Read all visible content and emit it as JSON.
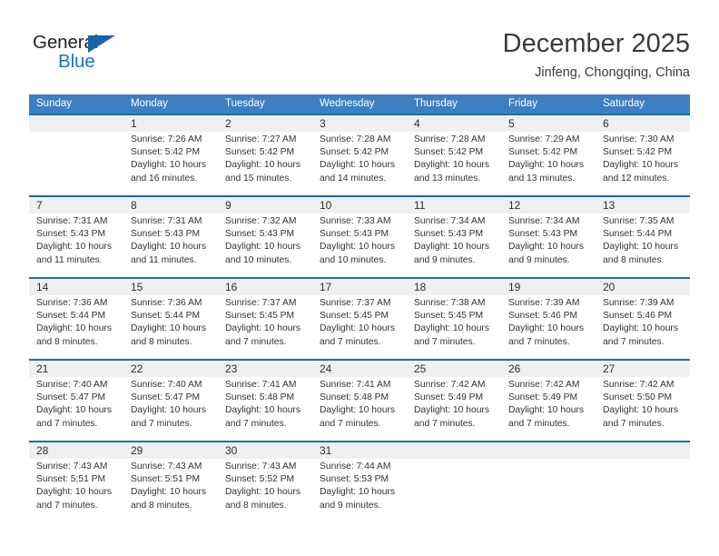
{
  "brand": {
    "name_part1": "General",
    "name_part2": "Blue",
    "triangle_color": "#1565a8",
    "blue_color": "#1777c4"
  },
  "header": {
    "title": "December 2025",
    "location": "Jinfeng, Chongqing, China"
  },
  "colors": {
    "header_blue": "#3d7fc1",
    "rule_blue": "#1f6cb0",
    "band_gray": "#f0f0f0",
    "text": "#333333"
  },
  "weekdays": [
    "Sunday",
    "Monday",
    "Tuesday",
    "Wednesday",
    "Thursday",
    "Friday",
    "Saturday"
  ],
  "weeks": [
    {
      "days": [
        {
          "num": "",
          "sunrise": "",
          "sunset": "",
          "daylight_line1": "",
          "daylight_line2": ""
        },
        {
          "num": "1",
          "sunrise": "Sunrise: 7:26 AM",
          "sunset": "Sunset: 5:42 PM",
          "daylight_line1": "Daylight: 10 hours",
          "daylight_line2": "and 16 minutes."
        },
        {
          "num": "2",
          "sunrise": "Sunrise: 7:27 AM",
          "sunset": "Sunset: 5:42 PM",
          "daylight_line1": "Daylight: 10 hours",
          "daylight_line2": "and 15 minutes."
        },
        {
          "num": "3",
          "sunrise": "Sunrise: 7:28 AM",
          "sunset": "Sunset: 5:42 PM",
          "daylight_line1": "Daylight: 10 hours",
          "daylight_line2": "and 14 minutes."
        },
        {
          "num": "4",
          "sunrise": "Sunrise: 7:28 AM",
          "sunset": "Sunset: 5:42 PM",
          "daylight_line1": "Daylight: 10 hours",
          "daylight_line2": "and 13 minutes."
        },
        {
          "num": "5",
          "sunrise": "Sunrise: 7:29 AM",
          "sunset": "Sunset: 5:42 PM",
          "daylight_line1": "Daylight: 10 hours",
          "daylight_line2": "and 13 minutes."
        },
        {
          "num": "6",
          "sunrise": "Sunrise: 7:30 AM",
          "sunset": "Sunset: 5:42 PM",
          "daylight_line1": "Daylight: 10 hours",
          "daylight_line2": "and 12 minutes."
        }
      ]
    },
    {
      "days": [
        {
          "num": "7",
          "sunrise": "Sunrise: 7:31 AM",
          "sunset": "Sunset: 5:43 PM",
          "daylight_line1": "Daylight: 10 hours",
          "daylight_line2": "and 11 minutes."
        },
        {
          "num": "8",
          "sunrise": "Sunrise: 7:31 AM",
          "sunset": "Sunset: 5:43 PM",
          "daylight_line1": "Daylight: 10 hours",
          "daylight_line2": "and 11 minutes."
        },
        {
          "num": "9",
          "sunrise": "Sunrise: 7:32 AM",
          "sunset": "Sunset: 5:43 PM",
          "daylight_line1": "Daylight: 10 hours",
          "daylight_line2": "and 10 minutes."
        },
        {
          "num": "10",
          "sunrise": "Sunrise: 7:33 AM",
          "sunset": "Sunset: 5:43 PM",
          "daylight_line1": "Daylight: 10 hours",
          "daylight_line2": "and 10 minutes."
        },
        {
          "num": "11",
          "sunrise": "Sunrise: 7:34 AM",
          "sunset": "Sunset: 5:43 PM",
          "daylight_line1": "Daylight: 10 hours",
          "daylight_line2": "and 9 minutes."
        },
        {
          "num": "12",
          "sunrise": "Sunrise: 7:34 AM",
          "sunset": "Sunset: 5:43 PM",
          "daylight_line1": "Daylight: 10 hours",
          "daylight_line2": "and 9 minutes."
        },
        {
          "num": "13",
          "sunrise": "Sunrise: 7:35 AM",
          "sunset": "Sunset: 5:44 PM",
          "daylight_line1": "Daylight: 10 hours",
          "daylight_line2": "and 8 minutes."
        }
      ]
    },
    {
      "days": [
        {
          "num": "14",
          "sunrise": "Sunrise: 7:36 AM",
          "sunset": "Sunset: 5:44 PM",
          "daylight_line1": "Daylight: 10 hours",
          "daylight_line2": "and 8 minutes."
        },
        {
          "num": "15",
          "sunrise": "Sunrise: 7:36 AM",
          "sunset": "Sunset: 5:44 PM",
          "daylight_line1": "Daylight: 10 hours",
          "daylight_line2": "and 8 minutes."
        },
        {
          "num": "16",
          "sunrise": "Sunrise: 7:37 AM",
          "sunset": "Sunset: 5:45 PM",
          "daylight_line1": "Daylight: 10 hours",
          "daylight_line2": "and 7 minutes."
        },
        {
          "num": "17",
          "sunrise": "Sunrise: 7:37 AM",
          "sunset": "Sunset: 5:45 PM",
          "daylight_line1": "Daylight: 10 hours",
          "daylight_line2": "and 7 minutes."
        },
        {
          "num": "18",
          "sunrise": "Sunrise: 7:38 AM",
          "sunset": "Sunset: 5:45 PM",
          "daylight_line1": "Daylight: 10 hours",
          "daylight_line2": "and 7 minutes."
        },
        {
          "num": "19",
          "sunrise": "Sunrise: 7:39 AM",
          "sunset": "Sunset: 5:46 PM",
          "daylight_line1": "Daylight: 10 hours",
          "daylight_line2": "and 7 minutes."
        },
        {
          "num": "20",
          "sunrise": "Sunrise: 7:39 AM",
          "sunset": "Sunset: 5:46 PM",
          "daylight_line1": "Daylight: 10 hours",
          "daylight_line2": "and 7 minutes."
        }
      ]
    },
    {
      "days": [
        {
          "num": "21",
          "sunrise": "Sunrise: 7:40 AM",
          "sunset": "Sunset: 5:47 PM",
          "daylight_line1": "Daylight: 10 hours",
          "daylight_line2": "and 7 minutes."
        },
        {
          "num": "22",
          "sunrise": "Sunrise: 7:40 AM",
          "sunset": "Sunset: 5:47 PM",
          "daylight_line1": "Daylight: 10 hours",
          "daylight_line2": "and 7 minutes."
        },
        {
          "num": "23",
          "sunrise": "Sunrise: 7:41 AM",
          "sunset": "Sunset: 5:48 PM",
          "daylight_line1": "Daylight: 10 hours",
          "daylight_line2": "and 7 minutes."
        },
        {
          "num": "24",
          "sunrise": "Sunrise: 7:41 AM",
          "sunset": "Sunset: 5:48 PM",
          "daylight_line1": "Daylight: 10 hours",
          "daylight_line2": "and 7 minutes."
        },
        {
          "num": "25",
          "sunrise": "Sunrise: 7:42 AM",
          "sunset": "Sunset: 5:49 PM",
          "daylight_line1": "Daylight: 10 hours",
          "daylight_line2": "and 7 minutes."
        },
        {
          "num": "26",
          "sunrise": "Sunrise: 7:42 AM",
          "sunset": "Sunset: 5:49 PM",
          "daylight_line1": "Daylight: 10 hours",
          "daylight_line2": "and 7 minutes."
        },
        {
          "num": "27",
          "sunrise": "Sunrise: 7:42 AM",
          "sunset": "Sunset: 5:50 PM",
          "daylight_line1": "Daylight: 10 hours",
          "daylight_line2": "and 7 minutes."
        }
      ]
    },
    {
      "days": [
        {
          "num": "28",
          "sunrise": "Sunrise: 7:43 AM",
          "sunset": "Sunset: 5:51 PM",
          "daylight_line1": "Daylight: 10 hours",
          "daylight_line2": "and 7 minutes."
        },
        {
          "num": "29",
          "sunrise": "Sunrise: 7:43 AM",
          "sunset": "Sunset: 5:51 PM",
          "daylight_line1": "Daylight: 10 hours",
          "daylight_line2": "and 8 minutes."
        },
        {
          "num": "30",
          "sunrise": "Sunrise: 7:43 AM",
          "sunset": "Sunset: 5:52 PM",
          "daylight_line1": "Daylight: 10 hours",
          "daylight_line2": "and 8 minutes."
        },
        {
          "num": "31",
          "sunrise": "Sunrise: 7:44 AM",
          "sunset": "Sunset: 5:53 PM",
          "daylight_line1": "Daylight: 10 hours",
          "daylight_line2": "and 9 minutes."
        },
        {
          "num": "",
          "sunrise": "",
          "sunset": "",
          "daylight_line1": "",
          "daylight_line2": ""
        },
        {
          "num": "",
          "sunrise": "",
          "sunset": "",
          "daylight_line1": "",
          "daylight_line2": ""
        },
        {
          "num": "",
          "sunrise": "",
          "sunset": "",
          "daylight_line1": "",
          "daylight_line2": ""
        }
      ]
    }
  ]
}
